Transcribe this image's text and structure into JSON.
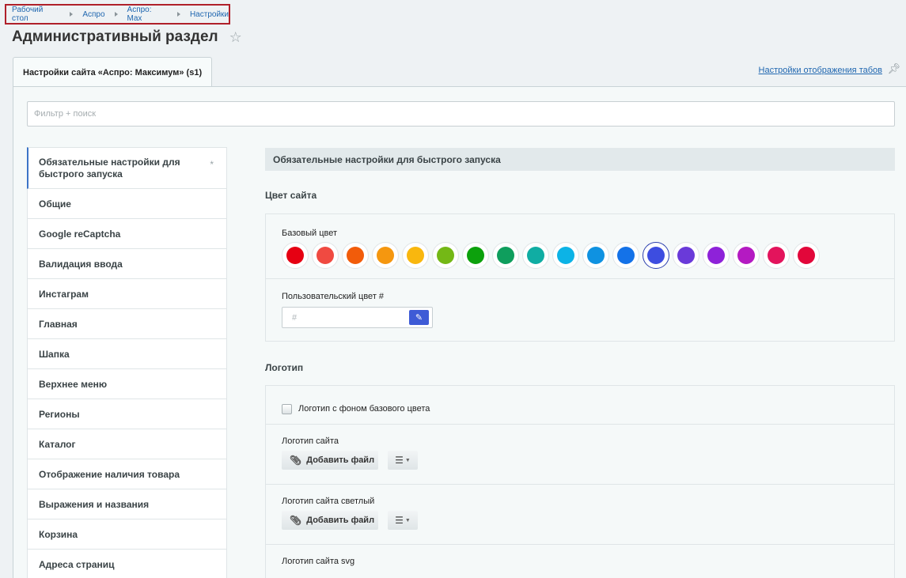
{
  "breadcrumb": [
    "Рабочий стол",
    "Аспро",
    "Аспро: Max",
    "Настройки"
  ],
  "page_title": "Административный раздел",
  "tab_label": "Настройки сайта «Аспро: Максимум» (s1)",
  "tabs_settings_link": "Настройки отображения табов",
  "filter_placeholder": "Фильтр + поиск",
  "sidebar": {
    "items": [
      "Обязательные настройки для быстрого запуска",
      "Общие",
      "Google reCaptcha",
      "Валидация ввода",
      "Инстаграм",
      "Главная",
      "Шапка",
      "Верхнее меню",
      "Регионы",
      "Каталог",
      "Отображение наличия товара",
      "Выражения и названия",
      "Корзина",
      "Адреса страниц"
    ],
    "required_marker": "*"
  },
  "section_title": "Обязательные настройки для быстрого запуска",
  "site_color": {
    "heading": "Цвет сайта",
    "base_color_label": "Базовый цвет",
    "colors": [
      "#e60012",
      "#f04a41",
      "#f25c0a",
      "#f5970f",
      "#f9b70e",
      "#74b816",
      "#0ca10c",
      "#0f9e5d",
      "#10ada3",
      "#0cb3e6",
      "#0f92e1",
      "#1472e8",
      "#3d4de0",
      "#6a3ad9",
      "#8e22d9",
      "#b41ac2",
      "#e3145c",
      "#e2073a"
    ],
    "selected_index": 12,
    "custom_color_label": "Пользовательский цвет #",
    "custom_color_placeholder": "#"
  },
  "logo": {
    "heading": "Логотип",
    "checkbox_label": "Логотип с фоном базового цвета",
    "site_logo_label": "Логотип сайта",
    "site_logo_light_label": "Логотип сайта светлый",
    "site_logo_svg_label": "Логотип сайта svg",
    "add_file_label": "Добавить файл"
  }
}
